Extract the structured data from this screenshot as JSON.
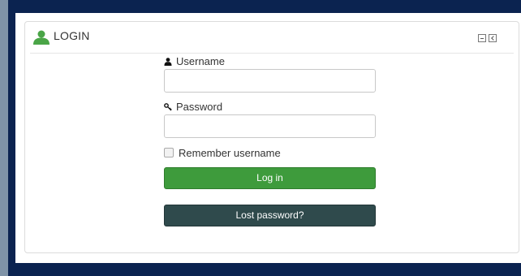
{
  "block": {
    "title": "LOGIN",
    "icon": "user-icon",
    "controls": [
      "minimize-icon",
      "dock-icon"
    ]
  },
  "form": {
    "username_label": "Username",
    "username_value": "",
    "password_label": "Password",
    "password_value": "",
    "remember_label": "Remember username",
    "remember_checked": false,
    "login_button": "Log in",
    "lost_password_button": "Lost password?"
  },
  "colors": {
    "page_background": "#0b2350",
    "accent_green": "#3e9b3c",
    "secondary_button": "#2f4a4c",
    "icon_green": "#4aa547"
  }
}
